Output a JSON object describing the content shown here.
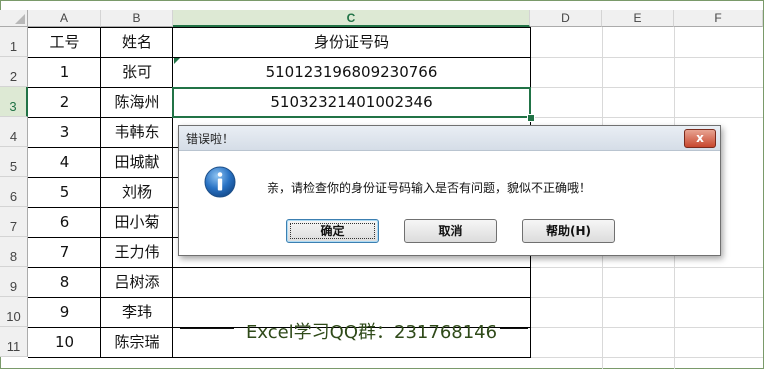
{
  "sheet": {
    "columns": [
      "A",
      "B",
      "C",
      "D",
      "E",
      "F"
    ],
    "selected_column": "C",
    "rows": [
      "1",
      "2",
      "3",
      "4",
      "5",
      "6",
      "7",
      "8",
      "9",
      "10",
      "11"
    ],
    "selected_row": "3",
    "header": {
      "id": "工号",
      "name": "姓名",
      "idcard": "身份证号码"
    },
    "data": [
      {
        "id": "1",
        "name": "张可",
        "idcard": "510123196809230766"
      },
      {
        "id": "2",
        "name": "陈海州",
        "idcard": "51032321401002346"
      },
      {
        "id": "3",
        "name": "韦韩东",
        "idcard": ""
      },
      {
        "id": "4",
        "name": "田城献",
        "idcard": ""
      },
      {
        "id": "5",
        "name": "刘杨",
        "idcard": ""
      },
      {
        "id": "6",
        "name": "田小菊",
        "idcard": ""
      },
      {
        "id": "7",
        "name": "王力伟",
        "idcard": ""
      },
      {
        "id": "8",
        "name": "吕树添",
        "idcard": ""
      },
      {
        "id": "9",
        "name": "李玮",
        "idcard": ""
      },
      {
        "id": "10",
        "name": "陈宗瑞",
        "idcard": ""
      }
    ]
  },
  "watermark": "Excel学习QQ群：231768146",
  "dialog": {
    "title": "错误啦！",
    "close_glyph": "x",
    "icon": "info-icon",
    "message": "亲，请检查你的身份证号码输入是否有问题，貌似不正确哦！",
    "buttons": {
      "ok": "确定",
      "cancel": "取消",
      "help": "帮助(H)"
    }
  },
  "colors": {
    "accent": "#217346",
    "header_bg": "#f0f0f0",
    "watermark": "#2f4a19"
  }
}
